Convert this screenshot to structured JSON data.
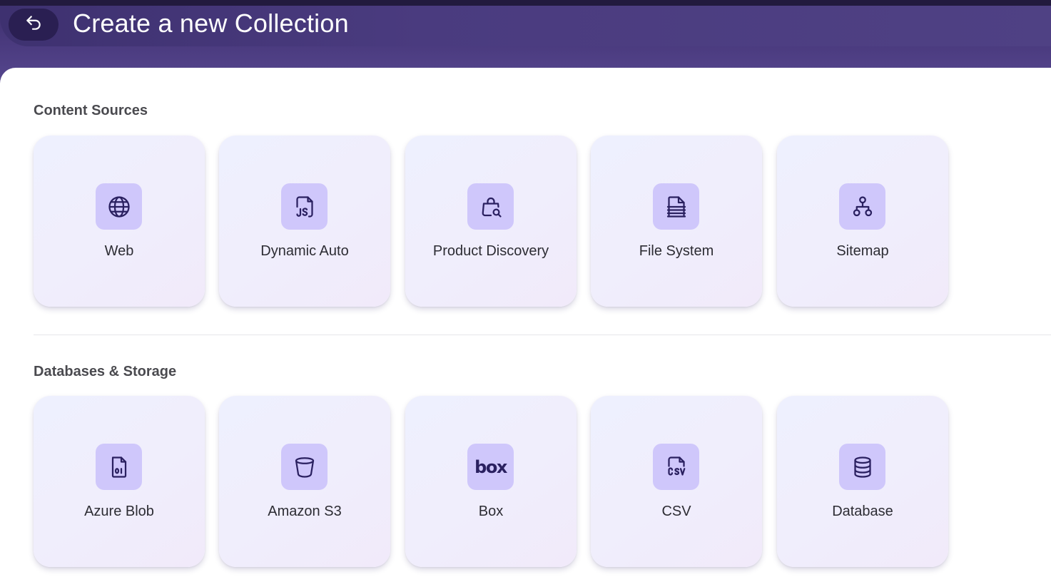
{
  "header": {
    "title": "Create a new Collection"
  },
  "sections": [
    {
      "title": "Content Sources",
      "cards": [
        {
          "label": "Web",
          "icon": "globe-icon"
        },
        {
          "label": "Dynamic Auto",
          "icon": "js-file-icon"
        },
        {
          "label": "Product Discovery",
          "icon": "bag-search-icon"
        },
        {
          "label": "File System",
          "icon": "document-icon"
        },
        {
          "label": "Sitemap",
          "icon": "sitemap-icon"
        }
      ]
    },
    {
      "title": "Databases & Storage",
      "cards": [
        {
          "label": "Azure Blob",
          "icon": "binary-file-icon"
        },
        {
          "label": "Amazon S3",
          "icon": "bucket-icon"
        },
        {
          "label": "Box",
          "icon": "box-logo-icon",
          "logo_text": "box"
        },
        {
          "label": "CSV",
          "icon": "csv-file-icon"
        },
        {
          "label": "Database",
          "icon": "database-icon"
        }
      ]
    }
  ],
  "colors": {
    "header_bg": "#4a3b7f",
    "back_button_bg": "#2a1f52",
    "icon_tile_bg": "#cfc7fb",
    "icon_stroke": "#2a2060"
  }
}
